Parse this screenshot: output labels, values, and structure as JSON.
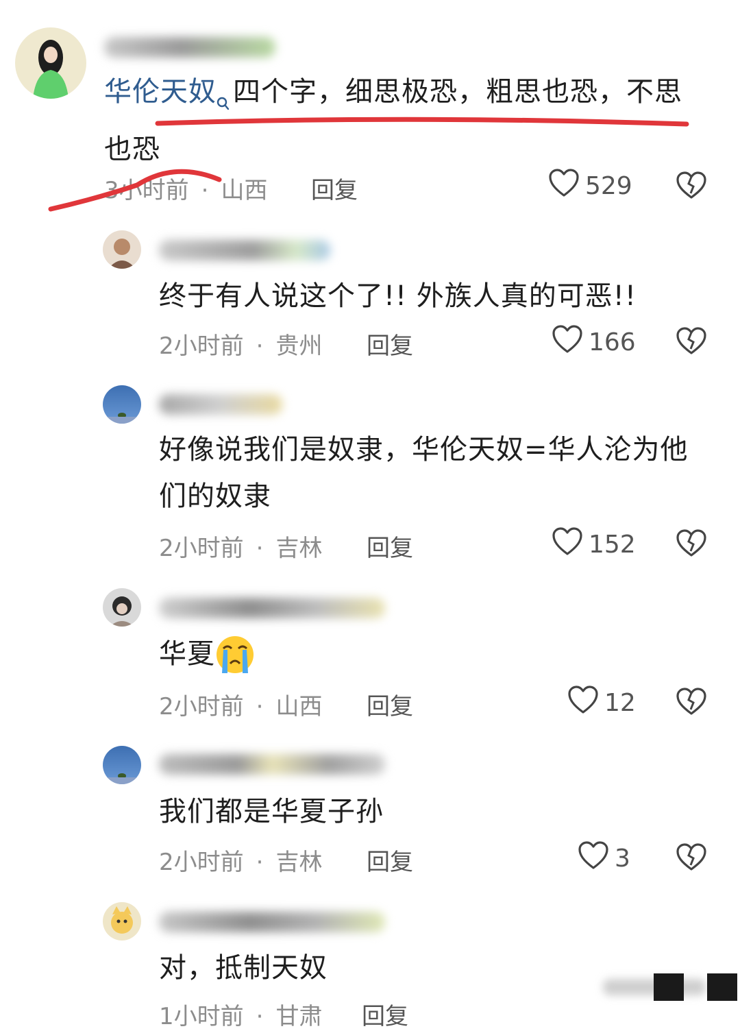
{
  "colors": {
    "link": "#2f5c8f",
    "meta": "#8c8c8c",
    "annotation": "#e0363a"
  },
  "comments": [
    {
      "link_text": "华伦天奴",
      "text": "四个字，细思极恐，粗思也恐，不思也恐",
      "time": "3小时前",
      "location": "山西",
      "reply": "回复",
      "likes": "529"
    },
    {
      "text": "终于有人说这个了!! 外族人真的可恶!!",
      "time": "2小时前",
      "location": "贵州",
      "reply": "回复",
      "likes": "166"
    },
    {
      "text": "好像说我们是奴隶，华伦天奴=华人沦为他们的奴隶",
      "time": "2小时前",
      "location": "吉林",
      "reply": "回复",
      "likes": "152"
    },
    {
      "text": "华夏",
      "emoji": "crying-face-icon",
      "time": "2小时前",
      "location": "山西",
      "reply": "回复",
      "likes": "12"
    },
    {
      "text": "我们都是华夏子孙",
      "time": "2小时前",
      "location": "吉林",
      "reply": "回复",
      "likes": "3"
    },
    {
      "text": "对，抵制天奴",
      "time": "1小时前",
      "location": "甘肃",
      "reply": "回复"
    }
  ]
}
